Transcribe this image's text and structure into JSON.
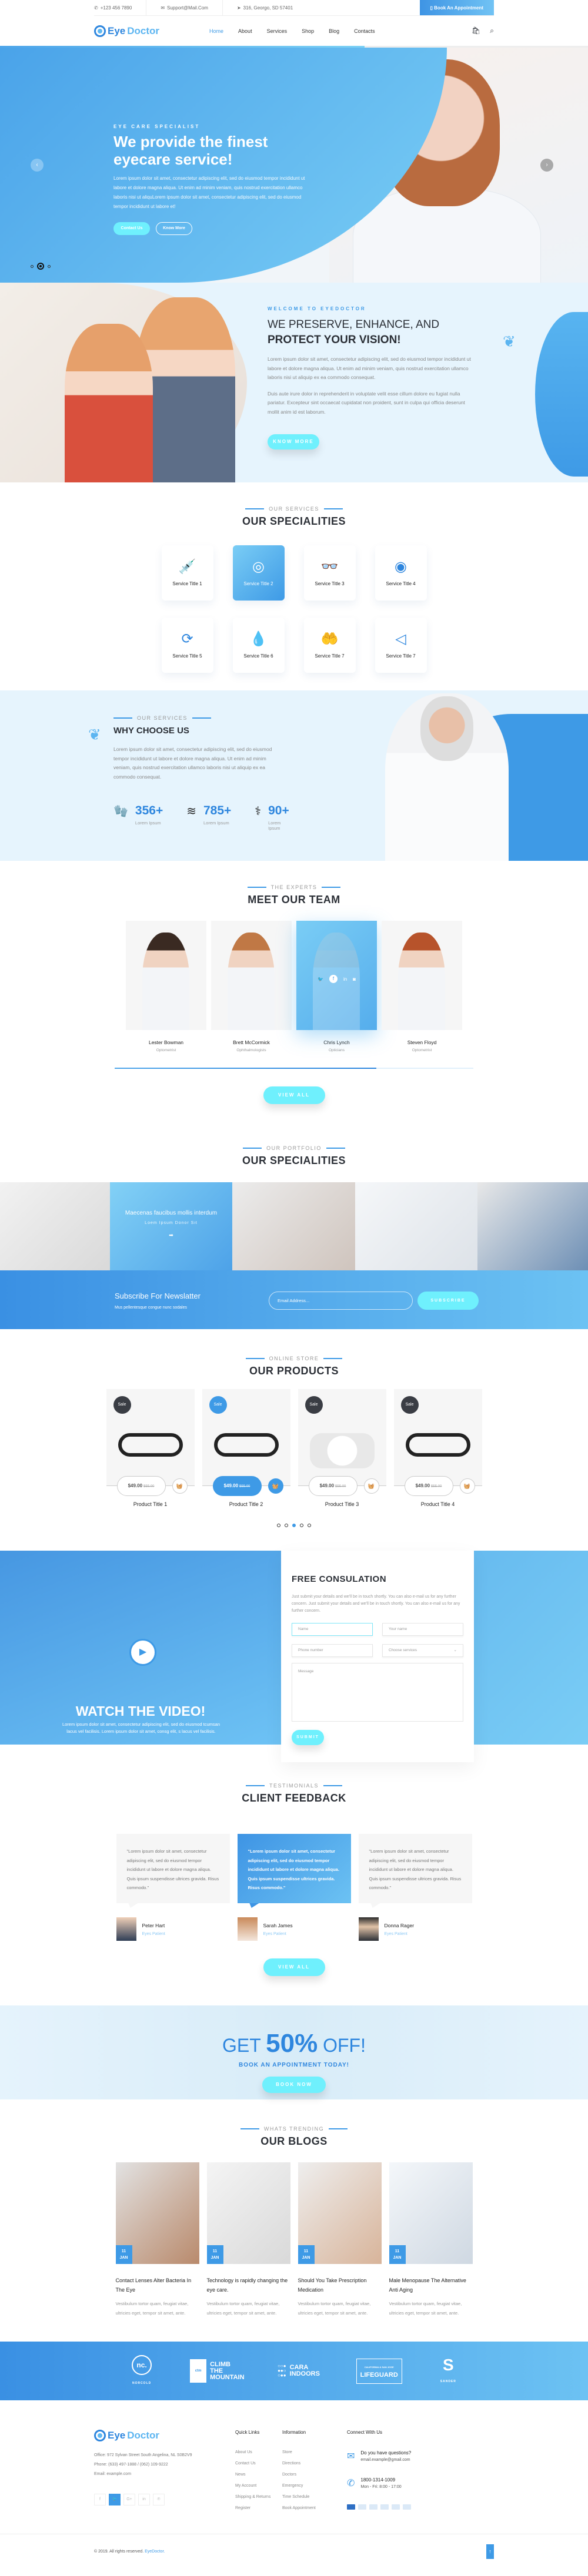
{
  "topbar": {
    "phone": "+123 456 7890",
    "email": "Support@Mail.Com",
    "address": "316, Georgo, SD 57401",
    "book_label": "Book An Appointment"
  },
  "nav": {
    "logo_part1": "Eye",
    "logo_part2": "Doctor",
    "items": [
      "Home",
      "About",
      "Services",
      "Shop",
      "Blog",
      "Contacts"
    ],
    "active": "Home",
    "cart_count": "0"
  },
  "hero": {
    "kicker": "EYE CARE SPECIALIST",
    "title": "We provide the finest eyecare service!",
    "body": "Lorem ipsum dolor sit amet, consectetur adipiscing elit, sed do eiusmod tempor incididunt ut labore et dolore magna aliqua. Ut enim ad minim veniam, quis nostrud exercitation ullamco laboris nisi ut aliquLorem ipsum dolor sit amet, consectetur adipiscing elit, sed do eiusmod tempor incididunt ut labore et!",
    "contact_label": "Contact Us",
    "know_label": "Know More",
    "slide_active": 2,
    "slide_count": 3
  },
  "welcome": {
    "kicker": "WELCOME TO EYEDOCTOR",
    "title_line1": "WE PRESERVE, ENHANCE, AND",
    "title_line2": "PROTECT YOUR VISION!",
    "para1": "Lorem ipsum dolor sit amet, consectetur adipiscing elit, sed do eiusmod tempor incididunt ut labore et dolore magna aliqua. Ut enim ad minim veniam, quis nostrud exercitation ullamco laboris nisi ut aliquip ex ea commodo consequat.",
    "para2": "Duis aute irure dolor in reprehenderit in voluptate velit esse cillum dolore eu fugiat nulla pariatur. Excepteur sint occaecat cupidatat non proident, sunt in culpa qui officia deserunt mollit anim id est laborum.",
    "button": "KNOW MORE"
  },
  "services": {
    "eyebrow": "OUR SERVICES",
    "title": "OUR SPECIALITIES",
    "items": [
      {
        "label": "Service Title 1",
        "icon": "eye-dropper-icon",
        "glyph": "💉"
      },
      {
        "label": "Service Title 2",
        "icon": "target-eye-icon",
        "glyph": "◎"
      },
      {
        "label": "Service Title 3",
        "icon": "glasses-icon",
        "glyph": "👓"
      },
      {
        "label": "Service Title 4",
        "icon": "eye-exam-icon",
        "glyph": "◉"
      },
      {
        "label": "Service Title 5",
        "icon": "eye-refresh-icon",
        "glyph": "⟳"
      },
      {
        "label": "Service Title 6",
        "icon": "eye-drops-icon",
        "glyph": "💧"
      },
      {
        "label": "Service Title 7",
        "icon": "eye-care-hands-icon",
        "glyph": "🤲"
      },
      {
        "label": "Service Title 7",
        "icon": "laser-eye-icon",
        "glyph": "◁"
      }
    ],
    "active_index": 1
  },
  "why": {
    "eyebrow": "OUR SERVICES",
    "title": "WHY CHOOSE US",
    "body": "Lorem ipsum dolor sit amet, consectetur adipiscing elit, sed do eiusmod tempor incididunt ut labore et dolore magna aliqua. Ut enim ad minim veniam, quis nostrud exercitation ullamco laboris nisi ut aliquip ex ea commodo consequat.",
    "stats": [
      {
        "value": "356+",
        "label": "Lorem Ipsum",
        "icon": "gloves-icon",
        "glyph": "🧤"
      },
      {
        "value": "785+",
        "label": "Lorem Ipsum",
        "icon": "layers-icon",
        "glyph": "≋"
      },
      {
        "value": "90+",
        "label": "Lorem Ipsum",
        "icon": "doctor-icon",
        "glyph": "⚕"
      }
    ]
  },
  "team": {
    "eyebrow": "THE EXPERTS",
    "title": "MEET OUR TEAM",
    "members": [
      {
        "name": "Lester Bowman",
        "role": "Optometrist"
      },
      {
        "name": "Brett McCormick",
        "role": "Ophthalmologists"
      },
      {
        "name": "Chris Lynch",
        "role": "Opticians"
      },
      {
        "name": "Steven Floyd",
        "role": "Optometrist"
      }
    ],
    "highlight_index": 2,
    "scroll_progress": 0.73,
    "button": "VIEW ALL"
  },
  "portfolio": {
    "eyebrow": "OUR PORTFOLIO",
    "title": "OUR SPECIALITIES",
    "highlight_caption": "Maecenas faucibus mollis interdum",
    "highlight_sub": "Loem Ipsum Donor Sit"
  },
  "newsletter": {
    "title": "Subscribe For Newslatter",
    "subtitle": "Mus pellentesque congue nunc sodales",
    "placeholder": "Email Address...",
    "button": "SUBSCRIBE"
  },
  "products": {
    "eyebrow": "ONLINE STORE",
    "title": "OUR PRODUCTS",
    "badge": "Sale",
    "items": [
      {
        "title": "Product Title 1",
        "price": "$49.00",
        "old_price": "$55.00"
      },
      {
        "title": "Product Title 2",
        "price": "$49.00",
        "old_price": "$55.00"
      },
      {
        "title": "Product Title 3",
        "price": "$49.00",
        "old_price": "$55.00"
      },
      {
        "title": "Product Title 4",
        "price": "$49.00",
        "old_price": "$55.00"
      }
    ],
    "highlight_index": 1,
    "page_active": 3,
    "page_count": 5
  },
  "video": {
    "title": "WATCH THE VIDEO!",
    "body": "Lorem ipsum dolor sit amet, consectetur adipiscing elit, sed do eiusmod tcumsan lacus vel facilisis. Lorem ipsum dolor sit amet, consg elit, s lacus vel facilisis."
  },
  "consult": {
    "title": "FREE CONSULATION",
    "body": "Just submit your details and we'll be in touch shortly. You can also e-mail us for any further concern. Just submit your details and we'll be in touch shortly. You can also e-mail us for any further concern.",
    "name_placeholder": "Name",
    "yourname_placeholder": "Your name",
    "phone_placeholder": "Phone number",
    "service_select": "Choose services",
    "message_placeholder": "Message",
    "submit": "SUBMIT"
  },
  "testimonials": {
    "eyebrow": "TESTIMONIALS",
    "title": "CLIENT FEEDBACK",
    "items": [
      {
        "quote": "\"Lorem ipsum dolor sit amet, consectetur adipiscing elit, sed do eiusmod tempor incididunt ut labore et dolore magna aliqua. Quis ipsum suspendisse ultrices gravida. Risus commodo.\"",
        "name": "Peter Hart",
        "role": "Eyes Patient"
      },
      {
        "quote": "\"Lorem ipsum dolor sit amet, consectetur adipiscing elit, sed do eiusmod tempor incididunt ut labore et dolore magna aliqua. Quis ipsum suspendisse ultrices gravida. Risus commodo.\"",
        "name": "Sarah James",
        "role": "Eyes Patient"
      },
      {
        "quote": "\"Lorem ipsum dolor sit amet, consectetur adipiscing elit, sed do eiusmod tempor incididunt ut labore et dolore magna aliqua. Quis ipsum suspendisse ultrices gravida. Risus commodo.\"",
        "name": "Donna Rager",
        "role": "Eyes Patient"
      }
    ],
    "highlight_index": 1,
    "button": "VIEW ALL"
  },
  "offer": {
    "get": "GET",
    "percent": "50%",
    "off": "OFF!",
    "subtitle": "BOOK AN APPOINTMENT TODAY!",
    "button": "BOOK NOW"
  },
  "blogs": {
    "eyebrow": "WHATS TRENDING",
    "title": "OUR BLOGS",
    "items": [
      {
        "day": "11",
        "month": "JAN",
        "title": "Contact Lenses Alter Bacteria In The Eye",
        "excerpt": "Vestibulum tortor quam, feugiat vitae, ultricies eget, tempor sit amet, ante."
      },
      {
        "day": "11",
        "month": "JAN",
        "title": "Technology is rapidly changing the eye care.",
        "excerpt": "Vestibulum tortor quam, feugiat vitae, ultricies eget, tempor sit amet, ante."
      },
      {
        "day": "11",
        "month": "JAN",
        "title": "Should You Take Prescription Medication",
        "excerpt": "Vestibulum tortor quam, feugiat vitae, ultricies eget, tempor sit amet, ante."
      },
      {
        "day": "11",
        "month": "JAN",
        "title": "Male Menopause The Alternative Anti Aging",
        "excerpt": "Vestibulum tortor quam, feugiat vitae, ultricies eget, tempor sit amet, ante."
      }
    ]
  },
  "brands": {
    "nc": "nc.",
    "nc_name": "NORCOLD",
    "ctm": "ctm",
    "ctm_name": "CLIMB THE MOUNTAIN",
    "cara": "CARA INDOORS",
    "cara_sub": "Unique Furniture Designs",
    "lifeguard_top": "CALIFORNIA & SAN JOSE",
    "lifeguard": "LIFEGUARD",
    "sander": "S",
    "sander_name": "SANDER"
  },
  "footer": {
    "address": "Office: 972 Sylvan Street South Angelina, NL S0B2V9",
    "phone": "Phone: (633) 497-1888 / (062) 109-9222",
    "email": "Email: example.com",
    "quick_title": "Quick Links",
    "quick_links": [
      "About Us",
      "Contact Us",
      "News",
      "My Account",
      "Shipping & Returns",
      "Register"
    ],
    "info_title": "Information",
    "info_links": [
      "Store",
      "Directions",
      "Doctors",
      "Emergency",
      "Time Schedule",
      "Book Appointment"
    ],
    "connect_title": "Connect With Us",
    "question": "Do you have questions?",
    "question_email": "email.example@gmail.com",
    "hotline": "1800-1314-1009",
    "hours": "Mon - Fri: 8:00 - 17:00",
    "copyright": "© 2019. All rights reserved.",
    "brand": "EyeDoctor."
  },
  "colors": {
    "primary": "#3e9ae6",
    "accent": "#6ff0fd",
    "dark": "#2b2f36",
    "light_bg": "#e6f4fd"
  }
}
